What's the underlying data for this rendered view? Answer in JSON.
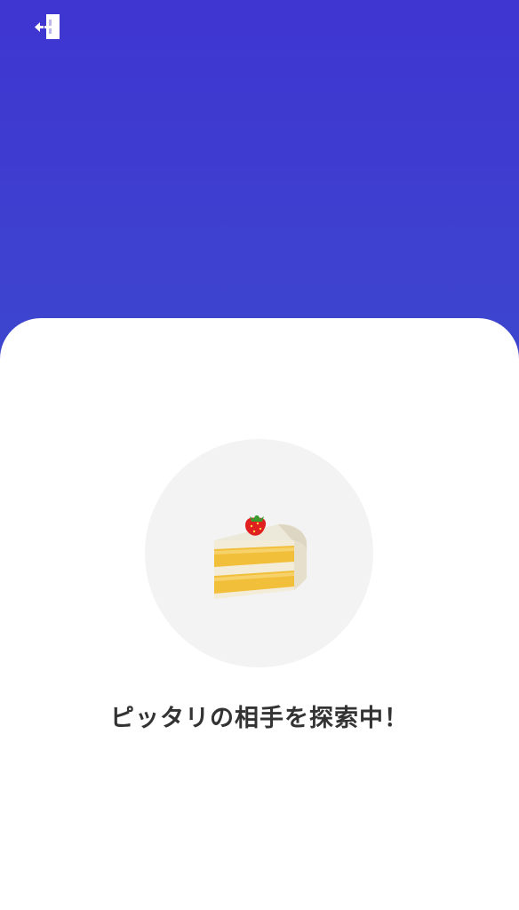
{
  "header": {
    "exit_icon": "exit-door-icon",
    "background_colors": [
      "#3f35d1",
      "#3a5bc8"
    ]
  },
  "sheet": {
    "avatar_icon": "strawberry-shortcake-icon",
    "avatar_bg": "#f3f3f3",
    "status_text": "ピッタリの相手を探索中！"
  }
}
